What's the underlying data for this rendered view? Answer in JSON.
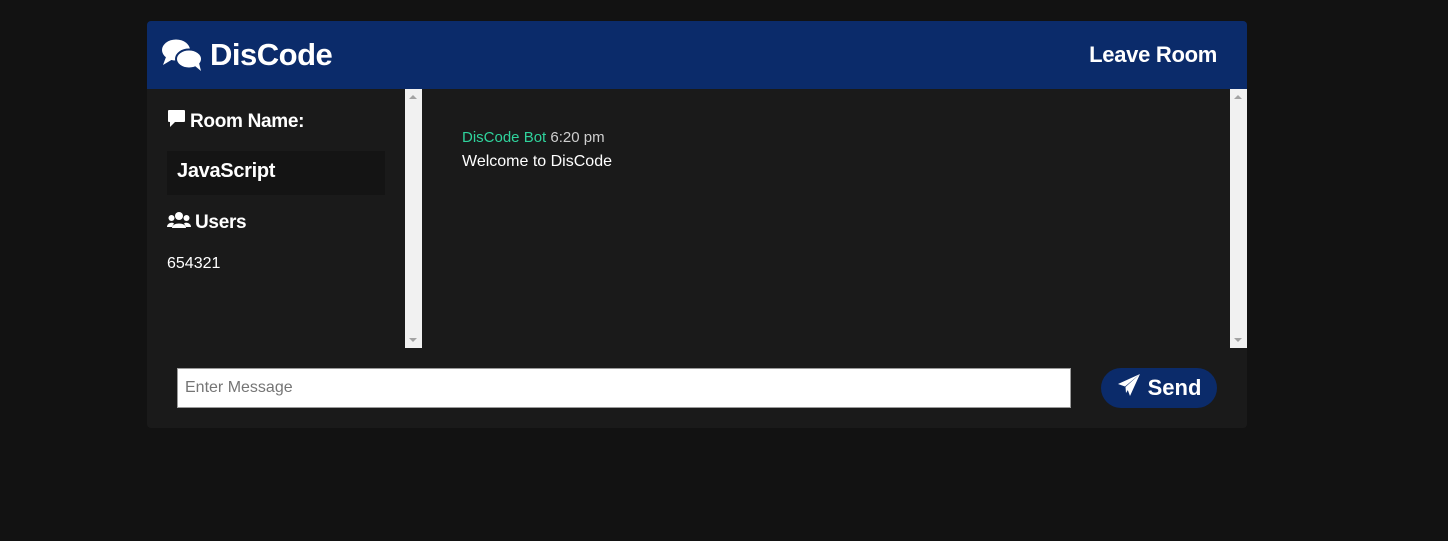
{
  "header": {
    "brand_title": "DisCode",
    "brand_icon": "comments-icon",
    "leave_label": "Leave Room"
  },
  "sidebar": {
    "room_heading": "Room Name:",
    "room_icon": "comment-icon",
    "room_name": "JavaScript",
    "users_heading": "Users",
    "users_icon": "users-icon",
    "users": [
      "654321"
    ]
  },
  "messages": [
    {
      "author": "DisCode Bot",
      "time": "6:20 pm",
      "text": "Welcome to DisCode"
    }
  ],
  "composer": {
    "placeholder": "Enter Message",
    "value": "",
    "send_label": "Send",
    "send_icon": "paper-plane-icon"
  },
  "colors": {
    "page_bg": "#121212",
    "panel_bg": "#1a1a1a",
    "accent": "#0b2b6a",
    "author": "#2fd39c"
  }
}
